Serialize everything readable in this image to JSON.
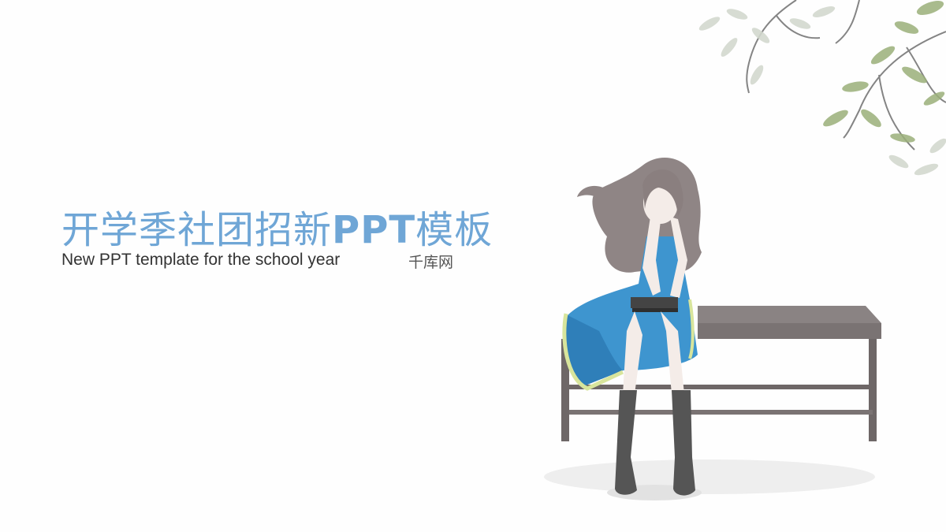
{
  "slide": {
    "title_cn": "开学季社团招新",
    "title_latin": "PPT",
    "title_cn_tail": "模板",
    "subtitle": "New PPT template for the school year",
    "brand": "千库网"
  },
  "colors": {
    "title": "#6fa6d6",
    "subtitle": "#333333",
    "dress": "#3e95cf",
    "bench": "#7d7676",
    "leaves": "#9bb07a"
  },
  "icons": [
    "leaf-branch-illustration",
    "girl-on-bench-illustration"
  ]
}
